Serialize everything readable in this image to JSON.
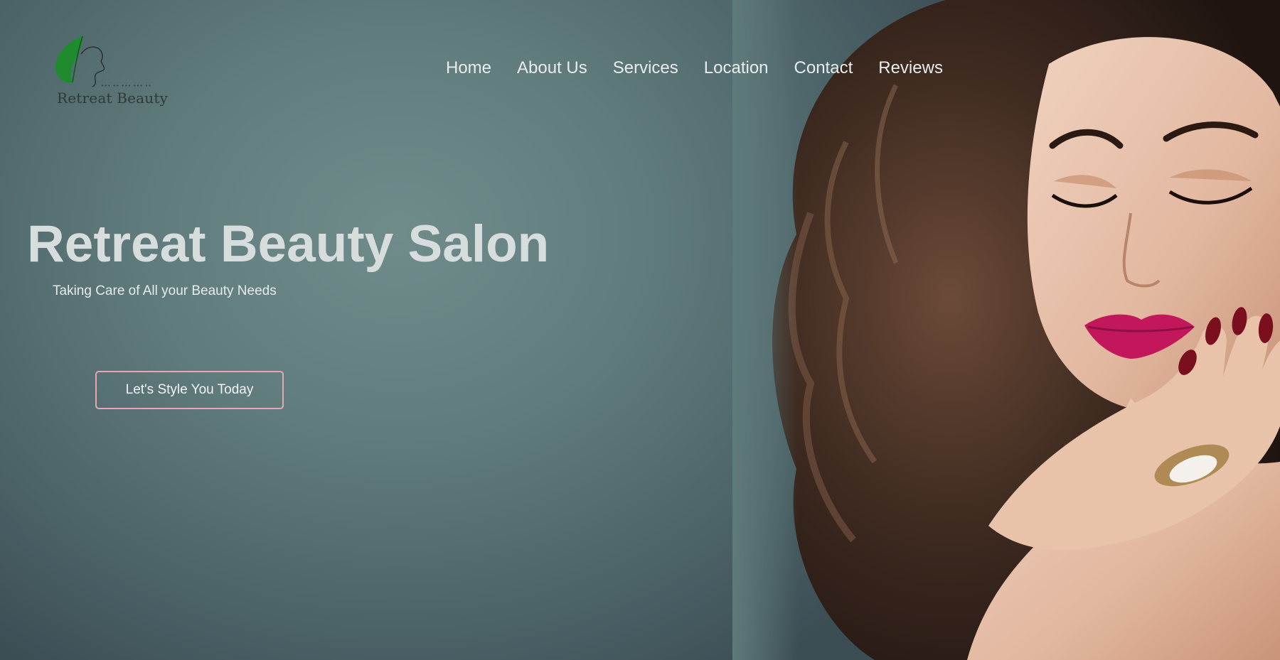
{
  "brand": {
    "name": "Retreat Beauty",
    "tagline": "••• •• ••• ••• ••"
  },
  "nav": {
    "items": [
      {
        "label": "Home"
      },
      {
        "label": "About Us"
      },
      {
        "label": "Services"
      },
      {
        "label": "Location"
      },
      {
        "label": "Contact"
      },
      {
        "label": "Reviews"
      }
    ]
  },
  "hero": {
    "title": "Retreat Beauty Salon",
    "subtitle": "Taking Care of All your Beauty Needs",
    "cta_label": "Let's Style You Today",
    "image": "woman-portrait"
  },
  "colors": {
    "background": "#607b7c",
    "nav_text": "#e8ecec",
    "cta_border": "#e4a7b5",
    "logo_green": "#1f8a2e",
    "lip": "#c2185b"
  }
}
